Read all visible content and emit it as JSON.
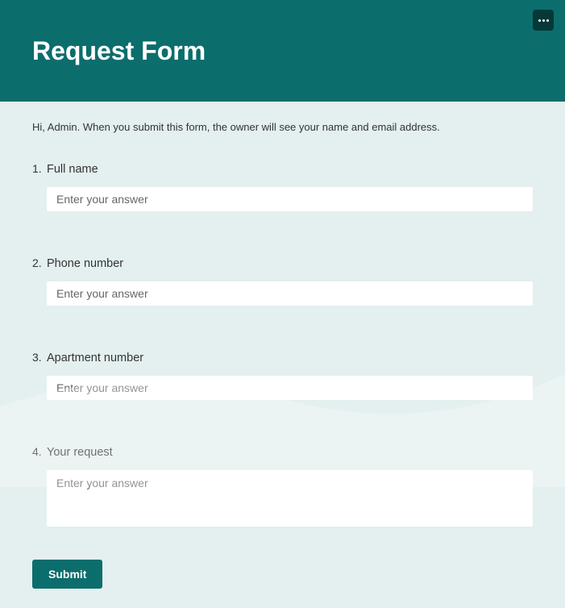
{
  "header": {
    "title": "Request Form"
  },
  "intro": "Hi, Admin. When you submit this form, the owner will see your name and email address.",
  "questions": [
    {
      "number": "1.",
      "label": "Full name",
      "placeholder": "Enter your answer",
      "type": "text"
    },
    {
      "number": "2.",
      "label": "Phone number",
      "placeholder": "Enter your answer",
      "type": "text"
    },
    {
      "number": "3.",
      "label": "Apartment number",
      "placeholder": "Enter your answer",
      "type": "text"
    },
    {
      "number": "4.",
      "label": "Your request",
      "placeholder": "Enter your answer",
      "type": "textarea"
    }
  ],
  "submit_label": "Submit"
}
